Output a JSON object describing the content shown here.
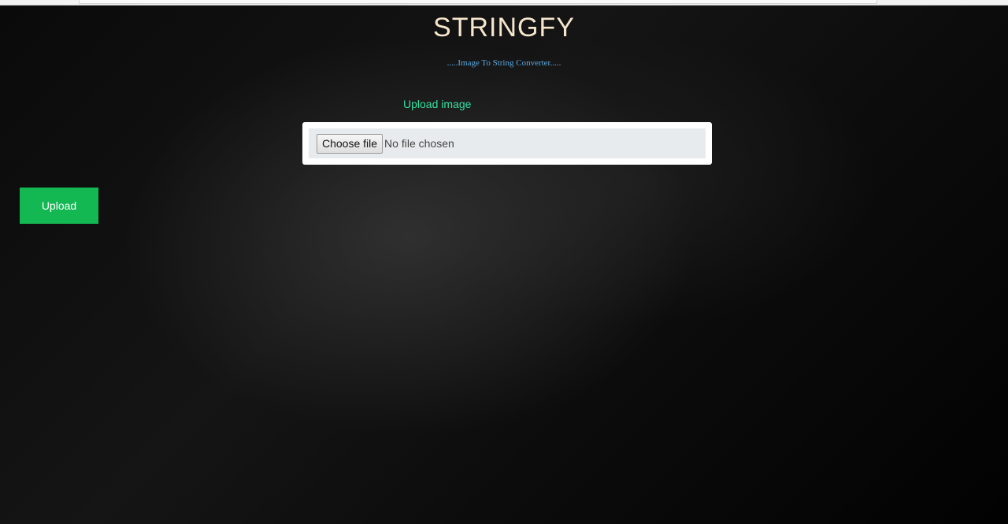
{
  "header": {
    "title": "STRINGFY",
    "subtitle": ".....Image To String Converter....."
  },
  "form": {
    "upload_label": "Upload image",
    "choose_file_label": "Choose file",
    "file_status": "No file chosen",
    "upload_button_label": "Upload"
  },
  "colors": {
    "title": "#f5e6cc",
    "subtitle": "#5aa9e0",
    "label": "#33e0a0",
    "upload_button": "#14b853",
    "background": "#050505"
  }
}
